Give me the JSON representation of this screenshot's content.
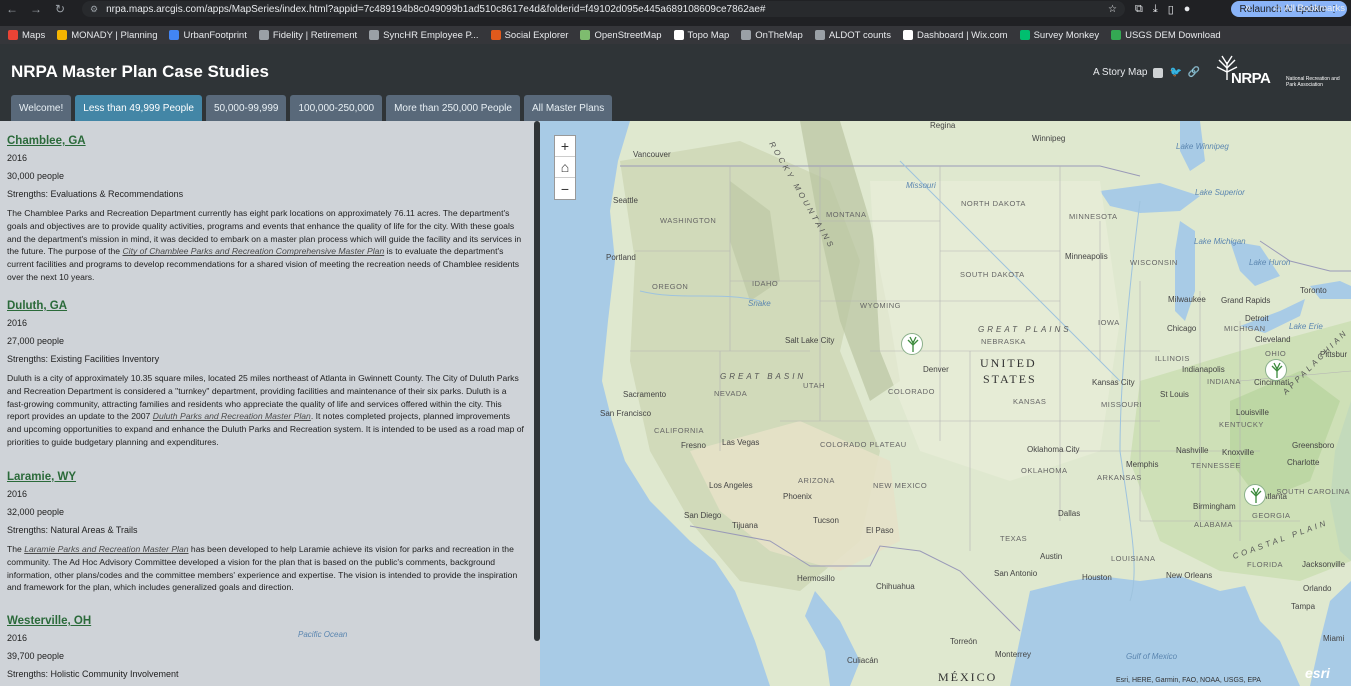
{
  "browser": {
    "url": "nrpa.maps.arcgis.com/apps/MapSeries/index.html?appid=7c489194b8c049099b1ad510c8617e4d&folderid=f49102d095e445a689108609ce7862ae#",
    "relaunch_label": "Relaunch to update"
  },
  "bookmarks": [
    {
      "label": "Maps",
      "color": "#ea4335"
    },
    {
      "label": "MONADY | Planning",
      "color": "#f4b400"
    },
    {
      "label": "UrbanFootprint",
      "color": "#4285f4"
    },
    {
      "label": "Fidelity | Retirement",
      "color": "#9aa0a6"
    },
    {
      "label": "SyncHR Employee P...",
      "color": "#9aa0a6"
    },
    {
      "label": "Social Explorer",
      "color": "#e05a1c"
    },
    {
      "label": "OpenStreetMap",
      "color": "#7ebc6f"
    },
    {
      "label": "Topo Map",
      "color": "#ffffff"
    },
    {
      "label": "OnTheMap",
      "color": "#9aa0a6"
    },
    {
      "label": "ALDOT counts",
      "color": "#9aa0a6"
    },
    {
      "label": "Dashboard | Wix.com",
      "color": "#ffffff"
    },
    {
      "label": "Survey Monkey",
      "color": "#00bf6f"
    },
    {
      "label": "USGS DEM Download",
      "color": "#34a853"
    }
  ],
  "bookmarks_more": "»",
  "all_bookmarks": "All Bookmarks",
  "header": {
    "title": "NRPA Master Plan Case Studies",
    "story_map_label": "A Story Map",
    "logo_name": "NRPA",
    "logo_sub": "National Recreation and Park Association"
  },
  "tabs": [
    {
      "label": "Welcome!",
      "active": false
    },
    {
      "label": "Less than 49,999 People",
      "active": true
    },
    {
      "label": "50,000-99,999",
      "active": false
    },
    {
      "label": "100,000-250,000",
      "active": false
    },
    {
      "label": "More than 250,000 People",
      "active": false
    },
    {
      "label": "All Master Plans",
      "active": false
    }
  ],
  "cases": [
    {
      "title": "Chamblee, GA",
      "year": "2016",
      "population": "30,000 people",
      "strengths": "Strengths: Evaluations & Recommendations",
      "body_before": "The Chamblee Parks and Recreation Department currently has eight park locations on approximately 76.11 acres. The department's goals and objectives are to provide quality activities, programs and events that enhance the quality of life for the city. With these goals and the department's mission in mind, it was decided to embark on a master plan process which will guide the facility and its services in the future. The purpose of the ",
      "link": "City of Chamblee Parks and Recreation Comprehensive Master Plan",
      "body_after": " is to evaluate the department's current facilities and programs to develop recommendations for a shared vision of meeting the recreation needs of Chamblee residents over the next 10 years."
    },
    {
      "title": "Duluth, GA",
      "year": "2016",
      "population": "27,000 people",
      "strengths": "Strengths: Existing Facilities Inventory",
      "body_before": "Duluth is a city of approximately 10.35 square miles, located 25 miles northeast of Atlanta in Gwinnett County. The City of Duluth Parks and Recreation Department is considered a \"turnkey\" department, providing facilities and maintenance of their six parks. Duluth is a fast-growing community, attracting families and residents who appreciate the quality of life and services offered within the city. This report provides an update to the 2007 ",
      "link": "Duluth Parks and Recreation Master Plan",
      "body_after": ". It notes completed projects, planned improvements and upcoming opportunities to expand and enhance the Duluth Parks and Recreation system. It is intended to be used as a road map of priorities to guide budgetary planning and expenditures."
    },
    {
      "title": "Laramie, WY",
      "year": "2016",
      "population": "32,000 people",
      "strengths": "Strengths: Natural Areas & Trails",
      "body_before": "The ",
      "link": "Laramie Parks and Recreation Master Plan",
      "body_after": " has been developed to help Laramie achieve its vision for parks and recreation in the community. The Ad Hoc Advisory Committee developed a vision for the plan that is based on the public's comments, background information, other plans/codes and the committee members' experience and expertise. The vision is intended to provide the inspiration and framework for the plan, which includes generalized goals and direction."
    },
    {
      "title": "Westerville, OH",
      "year": "2016",
      "population": "39,700 people",
      "strengths": "Strengths: Holistic Community Involvement",
      "body_before": "",
      "link": "",
      "body_after": ""
    }
  ],
  "map": {
    "zoom_in": "+",
    "home": "⌂",
    "zoom_out": "−",
    "labels": {
      "regina": "Regina",
      "winnipeg": "Winnipeg",
      "vancouver": "Vancouver",
      "seattle": "Seattle",
      "washington": "WASHINGTON",
      "montana": "MONTANA",
      "north_dakota": "NORTH DAKOTA",
      "minnesota": "MINNESOTA",
      "portland": "Portland",
      "oregon": "OREGON",
      "idaho": "IDAHO",
      "south_dakota": "SOUTH DAKOTA",
      "minneapolis": "Minneapolis",
      "wisconsin": "WISCONSIN",
      "toronto": "Toronto",
      "wyoming": "WYOMING",
      "milwaukee": "Milwaukee",
      "grand_rapids": "Grand Rapids",
      "detroit": "Detroit",
      "michigan": "MICHIGAN",
      "great_plains": "GREAT PLAINS",
      "iowa": "IOWA",
      "chicago": "Chicago",
      "cleveland": "Cleveland",
      "salt_lake": "Salt Lake City",
      "nebraska": "NEBRASKA",
      "united": "UNITED",
      "states": "STATES",
      "denver": "Denver",
      "illinois": "ILLINOIS",
      "indianapolis": "Indianapolis",
      "ohio": "OHIO",
      "pittsburgh": "Pittsbur",
      "sacramento": "Sacramento",
      "great_basin": "GREAT BASIN",
      "nevada": "NEVADA",
      "utah": "UTAH",
      "colorado": "COLORADO",
      "kansas_city": "Kansas City",
      "indiana": "INDIANA",
      "cincinnati": "Cincinnati",
      "st_louis": "St Louis",
      "missouri": "MISSOURI",
      "kansas": "KANSAS",
      "louisville": "Louisville",
      "san_francisco": "San Francisco",
      "california": "CALIFORNIA",
      "kentucky": "KENTUCKY",
      "las_vegas": "Las Vegas",
      "fresno": "Fresno",
      "colorado_plateau": "COLORADO PLATEAU",
      "oklahoma_city": "Oklahoma City",
      "nashville": "Nashville",
      "knoxville": "Knoxville",
      "greensboro": "Greensboro",
      "charlotte": "Charlotte",
      "memphis": "Memphis",
      "tennessee": "TENNESSEE",
      "oklahoma": "OKLAHOMA",
      "arizona": "ARIZONA",
      "new_mexico": "NEW MEXICO",
      "los_angeles": "Los Angeles",
      "arkansas": "ARKANSAS",
      "south_carolina": "SOUTH CAROLINA",
      "phoenix": "Phoenix",
      "birmingham": "Birmingham",
      "atlanta": "Atlanta",
      "dallas": "Dallas",
      "georgia": "GEORGIA",
      "san_diego": "San Diego",
      "tijuana": "Tijuana",
      "tucson": "Tucson",
      "el_paso": "El Paso",
      "alabama": "ALABAMA",
      "texas": "TEXAS",
      "coastal_plain": "COASTAL PLAIN",
      "austin": "Austin",
      "louisiana": "LOUISIANA",
      "florida": "FLORIDA",
      "jacksonville": "Jacksonville",
      "hermosillo": "Hermosillo",
      "san_antonio": "San Antonio",
      "houston": "Houston",
      "new_orleans": "New Orleans",
      "orlando": "Orlando",
      "chihuahua": "Chihuahua",
      "tampa": "Tampa",
      "miami": "Miami",
      "torreon": "Torreón",
      "monterrey": "Monterrey",
      "culiacan": "Culiacán",
      "gulf_mexico": "Gulf of Mexico",
      "mexico": "MÉXICO",
      "lake_superior": "Lake Superior",
      "lake_michigan": "Lake Michigan",
      "lake_huron": "Lake Huron",
      "lake_erie": "Lake Erie",
      "missouri_river": "Missouri",
      "snake": "Snake",
      "rocky": "ROCKY MOUNTAINS",
      "appalachian": "APPALACHIAN",
      "lake_winnipeg": "Lake Winnipeg",
      "pacific": "Pacific Ocean"
    },
    "attribution": "Esri, HERE, Garmin, FAO, NOAA, USGS, EPA",
    "esri": "esri"
  }
}
